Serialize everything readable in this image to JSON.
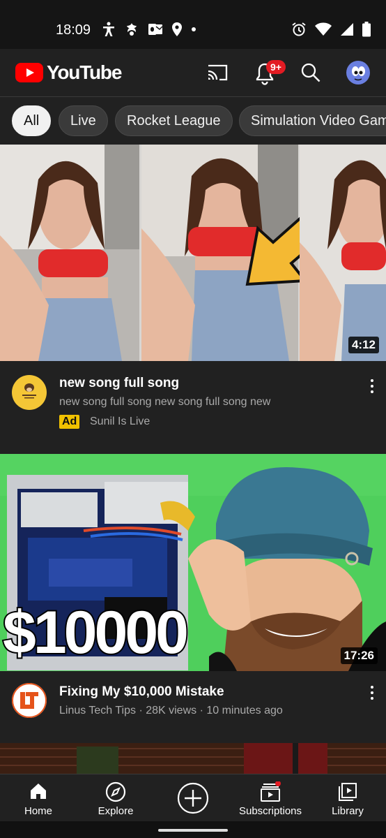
{
  "status_bar": {
    "time": "18:09",
    "left_icons": [
      "accessibility-icon",
      "bird-app-icon",
      "outlook-icon",
      "location-pin-icon",
      "dot-icon"
    ],
    "right_icons": [
      "alarm-icon",
      "wifi-icon",
      "signal-icon",
      "battery-icon"
    ]
  },
  "app_bar": {
    "logo_text": "YouTube",
    "notification_badge": "9+"
  },
  "chips": [
    "All",
    "Live",
    "Rocket League",
    "Simulation Video Games"
  ],
  "videos": [
    {
      "title": "new song full song",
      "description": "new song full song new song full song new",
      "ad_label": "Ad",
      "channel": "Sunil Is Live",
      "duration": "4:12"
    },
    {
      "title": "Fixing My $10,000 Mistake",
      "meta": "Linus Tech Tips · 28K views · 10 minutes ago",
      "duration": "17:26",
      "thumbnail_text": "$10000"
    }
  ],
  "bottom_nav": {
    "home": "Home",
    "explore": "Explore",
    "subscriptions": "Subscriptions",
    "library": "Library"
  },
  "colors": {
    "background": "#212121",
    "status_bar": "#151515",
    "youtube_red": "#ff0000",
    "badge_red": "#e31b23",
    "ad_yellow": "#f2c200",
    "text_secondary": "#aaaaaa"
  }
}
